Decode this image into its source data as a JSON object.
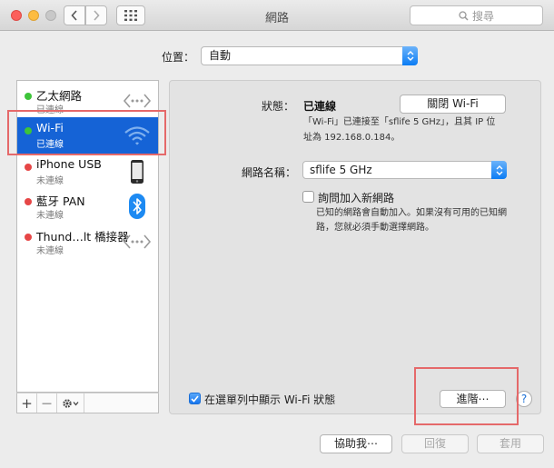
{
  "window": {
    "title": "網路"
  },
  "toolbar": {
    "search_placeholder": "搜尋"
  },
  "location": {
    "label": "位置：",
    "value": "自動"
  },
  "services": [
    {
      "name": "乙太網路",
      "status": "已連線",
      "dot_color": "#3ec43a",
      "icon": "ethernet-icon"
    },
    {
      "name": "Wi-Fi",
      "status": "已連線",
      "dot_color": "#3ec43a",
      "icon": "wifi-icon"
    },
    {
      "name": "iPhone USB",
      "status": "未連線",
      "dot_color": "#e64646",
      "icon": "iphone-icon"
    },
    {
      "name": "藍牙 PAN",
      "status": "未連線",
      "dot_color": "#e64646",
      "icon": "bluetooth-icon"
    },
    {
      "name": "Thund…lt 橋接器",
      "status": "未連線",
      "dot_color": "#e64646",
      "icon": "thunderbolt-bridge-icon"
    }
  ],
  "sidebar_footer": {
    "add": "+",
    "remove": "—"
  },
  "detail": {
    "status_label": "狀態：",
    "status_value": "已連線",
    "toggle_button": "關閉 Wi-Fi",
    "status_desc_line1": "「Wi-Fi」已連接至「sflife 5 GHz」，且其 IP 位",
    "status_desc_line2": "址為 192.168.0.184。",
    "network_name_label": "網路名稱：",
    "network_name_value": "sflife 5 GHz",
    "ask_join_label": "詢問加入新網路",
    "ask_join_desc_line1": "已知的網路會自動加入。如果沒有可用的已知網",
    "ask_join_desc_line2": "路，您就必須手動選擇網路。",
    "show_in_menu_label": "在選單列中顯示 Wi-Fi 狀態",
    "advanced_button": "進階⋯",
    "help_button": "?"
  },
  "bottom": {
    "assist": "協助我⋯",
    "revert": "回復",
    "apply": "套用"
  },
  "colors": {
    "selection": "#1563d6",
    "annotation": "#e5696a"
  }
}
